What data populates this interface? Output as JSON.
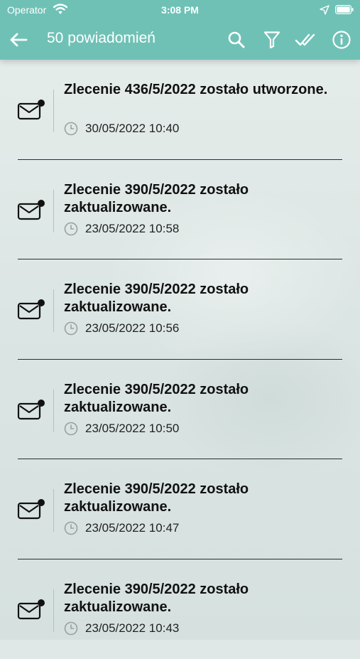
{
  "status_bar": {
    "carrier": "Operator",
    "time": "3:08 PM"
  },
  "header": {
    "title": "50 powiadomień",
    "actions": [
      "search-icon",
      "filter-icon",
      "mark-all-read-icon",
      "info-icon"
    ]
  },
  "colors": {
    "header_bg": "#6fc1b6",
    "text": "#111111",
    "divider": "#2a2f2e"
  },
  "notifications": [
    {
      "title": "Zlecenie 436/5/2022 zostało utworzone.",
      "time": "30/05/2022 10:40"
    },
    {
      "title": "Zlecenie 390/5/2022 zostało zaktualizowane.",
      "time": "23/05/2022 10:58"
    },
    {
      "title": "Zlecenie 390/5/2022 zostało zaktualizowane.",
      "time": "23/05/2022 10:56"
    },
    {
      "title": "Zlecenie 390/5/2022 zostało zaktualizowane.",
      "time": "23/05/2022 10:50"
    },
    {
      "title": "Zlecenie 390/5/2022 zostało zaktualizowane.",
      "time": "23/05/2022 10:47"
    },
    {
      "title": "Zlecenie 390/5/2022 zostało zaktualizowane.",
      "time": "23/05/2022 10:43"
    }
  ]
}
